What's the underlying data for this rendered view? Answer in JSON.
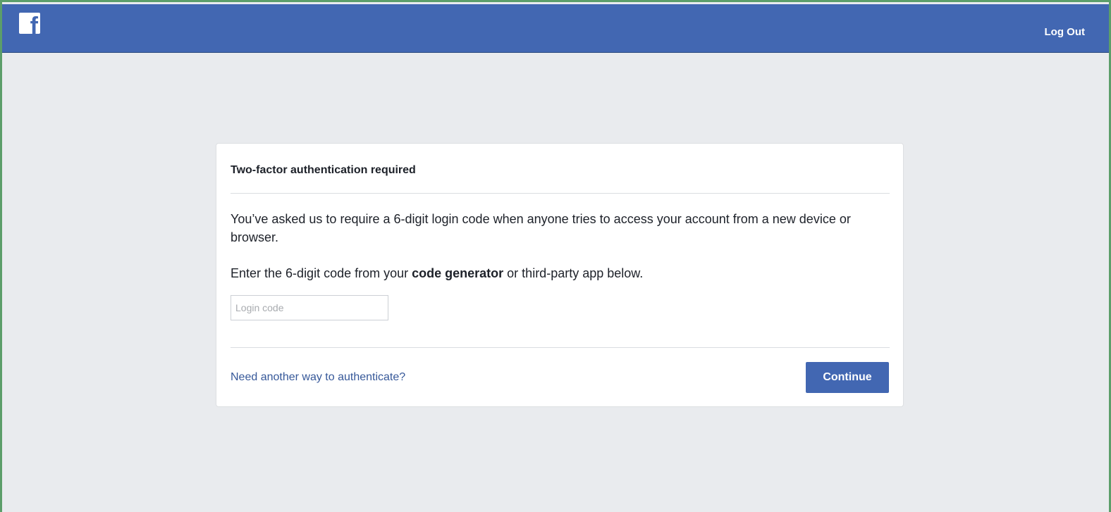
{
  "header": {
    "logo_letter": "f",
    "logout_label": "Log Out"
  },
  "card": {
    "title": "Two-factor authentication required",
    "description": "You’ve asked us to require a 6-digit login code when anyone tries to access your account from a new device or browser.",
    "instruction_before": "Enter the 6-digit code from your ",
    "instruction_bold": "code generator",
    "instruction_after": " or third-party app below.",
    "code_input": {
      "value": "",
      "placeholder": "Login code"
    },
    "alt_link": "Need another way to authenticate?",
    "continue_label": "Continue"
  },
  "colors": {
    "brand": "#4267b2",
    "link": "#365899",
    "background": "#e9ebee",
    "frame_border": "#5c9e6a"
  },
  "icons": {
    "logo": "facebook-logo-icon"
  }
}
